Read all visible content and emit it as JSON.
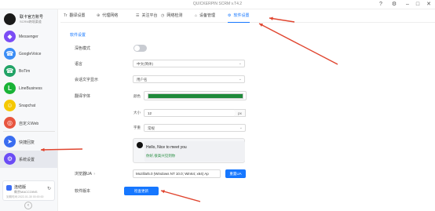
{
  "window": {
    "title": "QUICKERPIN SCRM v.T4.2",
    "controls": [
      "?",
      "⚙",
      "–",
      "□",
      "✕"
    ]
  },
  "profile": {
    "name": "联卡官方账号",
    "subtitle": "SCRM跨境渠道"
  },
  "sidebar": {
    "items": [
      {
        "label": "Messenger",
        "color": "#7b4cf5",
        "icon": "messenger-icon",
        "glyph": "◆"
      },
      {
        "label": "GoogleVoice",
        "color": "#3b8df5",
        "icon": "googlevoice-icon",
        "glyph": "☎"
      },
      {
        "label": "BoTim",
        "color": "#21a366",
        "icon": "botim-icon",
        "glyph": "☎"
      },
      {
        "label": "LineBusiness",
        "color": "#19b336",
        "icon": "line-icon",
        "glyph": "L"
      },
      {
        "label": "Snapchat",
        "color": "#f5c800",
        "icon": "snapchat-icon",
        "glyph": "☺"
      },
      {
        "label": "自定义Web",
        "color": "#e8553f",
        "icon": "chrome-icon",
        "glyph": "◎"
      },
      {
        "label": "快捷回复",
        "color": "#3a6df0",
        "icon": "quick-reply-icon",
        "glyph": "➤"
      },
      {
        "label": "系统设置",
        "color": "#6b4cf5",
        "icon": "settings-icon",
        "glyph": "⚙"
      }
    ],
    "plan": {
      "title": "连结版",
      "line2": "剩余MACCOINS",
      "line3": "到期时间:2022-01-30 00:00:00",
      "refresh": "↻"
    },
    "collapse": "‹"
  },
  "tabs": [
    {
      "label": "翻译设置",
      "icon": "Tr"
    },
    {
      "label": "代理网络",
      "icon": "⊕"
    },
    {
      "label": "关注平台",
      "icon": "☰"
    },
    {
      "label": "网络检测",
      "icon": "◷"
    },
    {
      "label": "设备管理",
      "icon": "⌂"
    },
    {
      "label": "软件设置",
      "icon": "⚙",
      "active": true
    }
  ],
  "settings": {
    "section_title": "软件设置",
    "dark_mode_label": "深色模式",
    "language_label": "语言",
    "language_value": "中文(简体)",
    "session_label": "会话文字显示",
    "session_value": "用户名",
    "font_label": "翻译字体",
    "color_label": "颜色",
    "color_value": "#1f8a3a",
    "size_label": "大小",
    "size_value": "12",
    "size_unit": "px",
    "weight_label": "字重",
    "weight_value": "常规",
    "preview_message": "Hello, Nice to meet you",
    "preview_translation": "你好,很高兴见到你",
    "ua_label": "浏览器UA",
    "ua_help": "?",
    "ua_value": "Mozilla/5.0 (Windows NT 10.0; Win64; x64) Ap",
    "ua_button": "重置UA",
    "version_label": "软件版本",
    "check_update_button": "检查更新"
  },
  "colors": {
    "accent": "#1677ff",
    "annotation_arrow": "#e0452f"
  }
}
